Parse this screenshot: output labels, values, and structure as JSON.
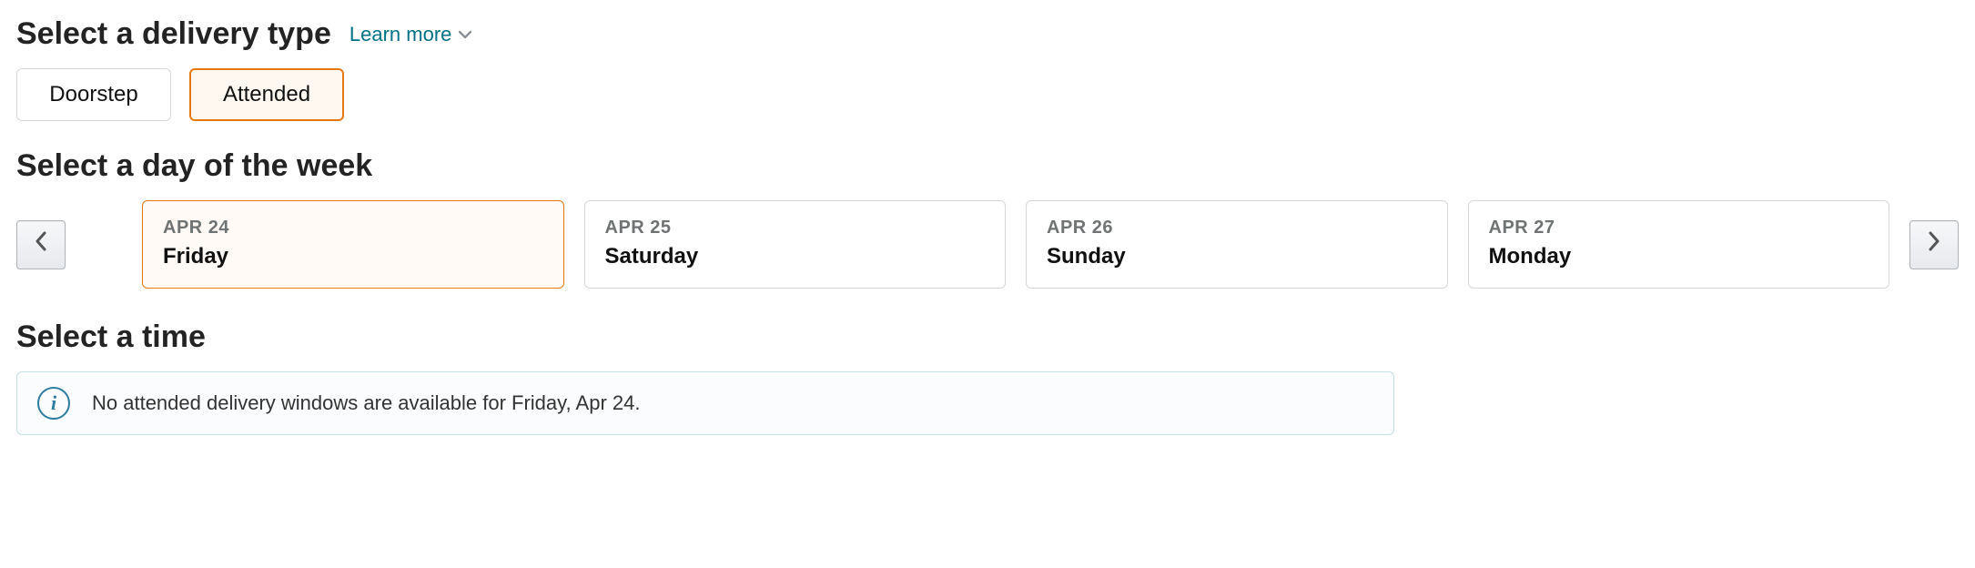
{
  "colors": {
    "accent_orange": "#e47911",
    "link_teal": "#007185",
    "info_border": "#c7e0e6",
    "info_icon": "#2e7ca0"
  },
  "delivery_type": {
    "heading": "Select a delivery type",
    "learn_more_label": "Learn more",
    "options": [
      {
        "label": "Doorstep",
        "selected": false
      },
      {
        "label": "Attended",
        "selected": true
      }
    ]
  },
  "day_select": {
    "heading": "Select a day of the week",
    "days": [
      {
        "date_label": "APR 24",
        "day_name": "Friday",
        "selected": true
      },
      {
        "date_label": "APR 25",
        "day_name": "Saturday",
        "selected": false
      },
      {
        "date_label": "APR 26",
        "day_name": "Sunday",
        "selected": false
      },
      {
        "date_label": "APR 27",
        "day_name": "Monday",
        "selected": false
      }
    ]
  },
  "time_select": {
    "heading": "Select a time",
    "info_message": "No attended delivery windows are available for Friday, Apr 24."
  }
}
